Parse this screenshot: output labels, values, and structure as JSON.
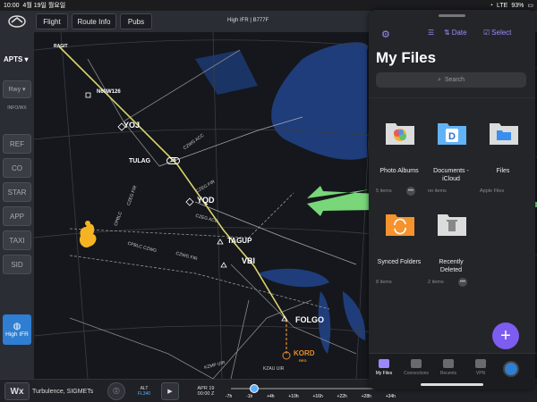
{
  "status": {
    "time": "10:00",
    "date": "4월 19일 월요일",
    "network": "LTE",
    "battery": "93%"
  },
  "toolbar": {
    "flight": "Flight",
    "route_info": "Route Info",
    "pubs": "Pubs",
    "chart_title": "High IFR | B777F"
  },
  "sidebar": {
    "apts": "APTS ▾",
    "rwy": "Rwy ▾",
    "info": "INFO/WX",
    "buttons": [
      "REF",
      "CO",
      "STAR",
      "APP",
      "TAXI",
      "SID"
    ],
    "layer": "High IFR"
  },
  "map": {
    "waypoints": {
      "ragit": "RAGIT",
      "n60w126": "N60W126",
      "yoj": "YOJ",
      "tulag": "TULAG",
      "route16": "16",
      "yqd": "YQD",
      "tagup": "TAGUP",
      "vbi": "VBI",
      "folgo": "FOLGO",
      "kord": "KORD",
      "kord_sub": "REG"
    },
    "airways": {
      "czwg_acc": "CZWG ACC",
      "czeg_fir": "CZEG FIR",
      "czeg_acc": "CZEG ACC",
      "cpbl_c": "CPBLC",
      "czeg_fir2": "CZEG FIR",
      "cpblc_czwg": "CPBLC CZWG",
      "czwg_fir": "CZWG FIR",
      "kzmp_uir": "KZMP UIR",
      "kzau_uir": "KZAU UIR"
    }
  },
  "bottom": {
    "wx": "Wx",
    "turbulence": "Turbulence, SIGMETs",
    "alt_label": "ALT",
    "alt_value": "FL340",
    "date": "APR 19",
    "time": "00:00 Z",
    "ticks": [
      "-7h",
      "-1h",
      "+4h",
      "+10h",
      "+16h",
      "+22h",
      "+28h",
      "+34h"
    ]
  },
  "files_panel": {
    "sort_label": "Date",
    "select_label": "Select",
    "title": "My Files",
    "search_placeholder": "Search",
    "tiles": [
      {
        "name": "Photo Albums",
        "meta": "5 items"
      },
      {
        "name": "Documents - iCloud",
        "meta": "no items"
      },
      {
        "name": "Files",
        "meta": "Apple Files"
      },
      {
        "name": "Synced Folders",
        "meta": "8 items"
      },
      {
        "name": "Recently Deleted",
        "meta": "2 items"
      }
    ],
    "tabs": [
      "My Files",
      "Connections",
      "Recents",
      "VPN"
    ]
  },
  "colors": {
    "route": "#d9d46a",
    "accent": "#9d87ff",
    "arrow": "#7ee07e",
    "water": "#1f3d7a",
    "kord": "#e58a2c"
  }
}
